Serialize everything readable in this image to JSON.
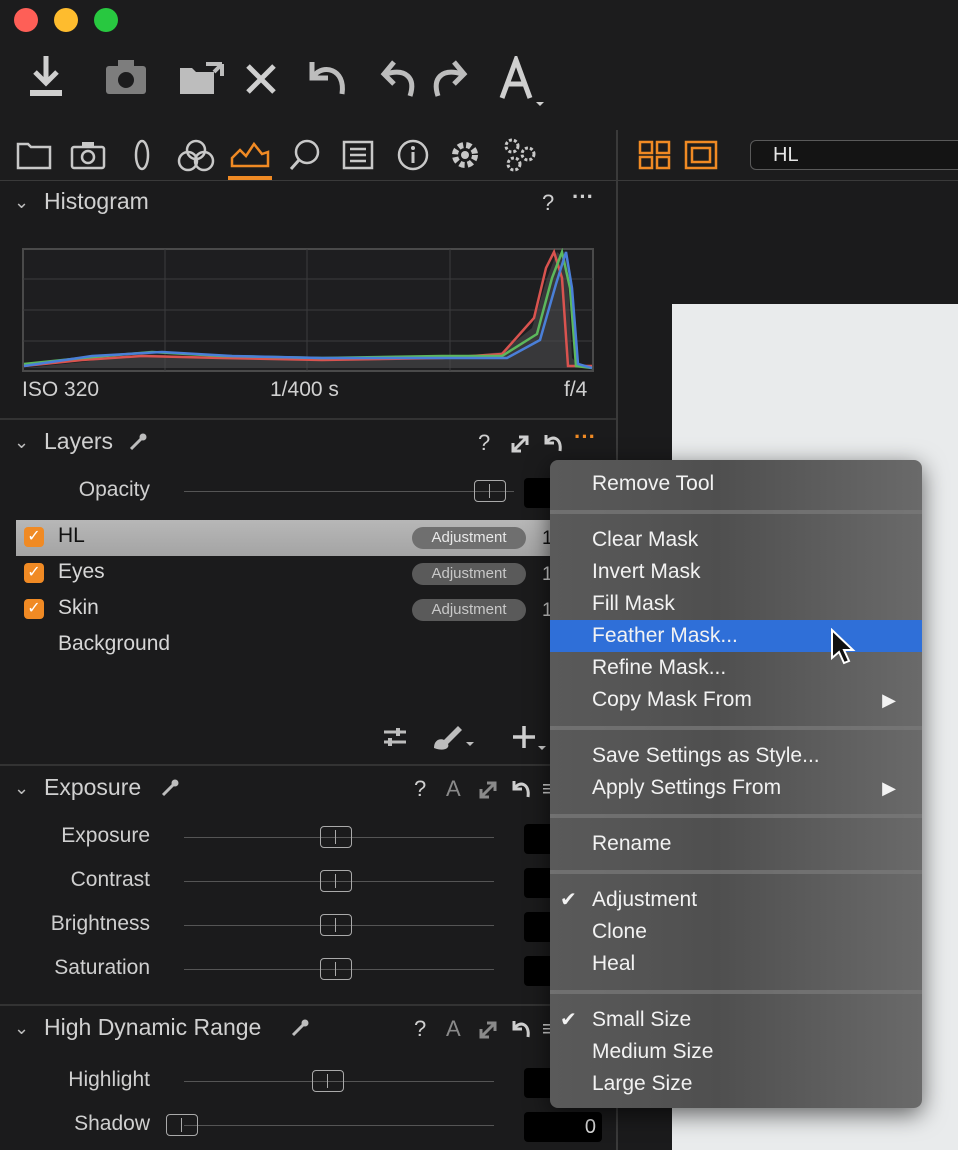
{
  "toolbar": {
    "icons": [
      "import-icon",
      "camera-icon",
      "folder-icon",
      "delete-icon",
      "revert-icon",
      "undo-icon",
      "redo-icon",
      "text-icon"
    ]
  },
  "viewer": {
    "layer_field": "HL"
  },
  "histogram": {
    "title": "Histogram",
    "iso": "ISO 320",
    "shutter": "1/400 s",
    "aperture": "f/4"
  },
  "layers": {
    "title": "Layers",
    "opacity_label": "Opacity",
    "items": [
      {
        "name": "HL",
        "type": "Adjustment",
        "value": "1",
        "checked": true
      },
      {
        "name": "Eyes",
        "type": "Adjustment",
        "value": "1",
        "checked": true
      },
      {
        "name": "Skin",
        "type": "Adjustment",
        "value": "1",
        "checked": true
      },
      {
        "name": "Background"
      }
    ]
  },
  "exposure": {
    "title": "Exposure",
    "auto_label": "A",
    "sliders": [
      {
        "label": "Exposure"
      },
      {
        "label": "Contrast"
      },
      {
        "label": "Brightness"
      },
      {
        "label": "Saturation"
      }
    ]
  },
  "hdr": {
    "title": "High Dynamic Range",
    "auto_label": "A",
    "sliders": [
      {
        "label": "Highlight"
      },
      {
        "label": "Shadow",
        "value": "0"
      }
    ]
  },
  "context_menu": {
    "items": [
      {
        "label": "Remove Tool"
      },
      {
        "label": "Clear Mask"
      },
      {
        "label": "Invert Mask"
      },
      {
        "label": "Fill Mask"
      },
      {
        "label": "Feather Mask...",
        "highlighted": true
      },
      {
        "label": "Refine Mask..."
      },
      {
        "label": "Copy Mask From"
      },
      {
        "label": "Save Settings as Style..."
      },
      {
        "label": "Apply Settings From"
      },
      {
        "label": "Rename"
      },
      {
        "label": "Adjustment",
        "checked": true
      },
      {
        "label": "Clone"
      },
      {
        "label": "Heal"
      },
      {
        "label": "Small Size",
        "checked": true
      },
      {
        "label": "Medium Size"
      },
      {
        "label": "Large Size"
      }
    ]
  },
  "colors": {
    "accent": "#f08a24",
    "highlight": "#2f6fd8"
  }
}
